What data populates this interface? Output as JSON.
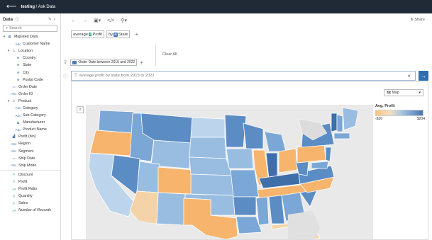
{
  "header": {
    "workbook": "testing",
    "page": "Ask Data"
  },
  "sidebar": {
    "title": "Data",
    "search_placeholder": "Search",
    "fields": [
      {
        "indent": 0,
        "twisty": "▾",
        "icon": "▦",
        "cls": "dim",
        "label": "Migrated Data",
        "icon_name": "table-icon"
      },
      {
        "indent": 2,
        "twisty": "",
        "icon": "Abc",
        "cls": "dim",
        "label": "Customer Name",
        "icon_name": "text-field-icon"
      },
      {
        "indent": 1,
        "twisty": "▾",
        "icon": "♙",
        "cls": "dim",
        "label": "Location",
        "icon_name": "hierarchy-icon"
      },
      {
        "indent": 2,
        "twisty": "",
        "icon": "⊕",
        "cls": "dim",
        "label": "Country",
        "icon_name": "globe-icon"
      },
      {
        "indent": 2,
        "twisty": "",
        "icon": "⊕",
        "cls": "dim",
        "label": "State",
        "icon_name": "globe-icon"
      },
      {
        "indent": 2,
        "twisty": "",
        "icon": "⊕",
        "cls": "dim",
        "label": "City",
        "icon_name": "globe-icon"
      },
      {
        "indent": 2,
        "twisty": "",
        "icon": "⊕",
        "cls": "dim",
        "label": "Postal Code",
        "icon_name": "globe-icon"
      },
      {
        "indent": 1,
        "twisty": "",
        "icon": "▭",
        "cls": "dim",
        "label": "Order Date",
        "icon_name": "calendar-icon"
      },
      {
        "indent": 1,
        "twisty": "",
        "icon": "Abc",
        "cls": "dim",
        "label": "Order ID",
        "icon_name": "text-field-icon"
      },
      {
        "indent": 1,
        "twisty": "▾",
        "icon": "♙",
        "cls": "dim",
        "label": "Product",
        "icon_name": "hierarchy-icon"
      },
      {
        "indent": 2,
        "twisty": "",
        "icon": "Abc",
        "cls": "dim",
        "label": "Category",
        "icon_name": "text-field-icon"
      },
      {
        "indent": 2,
        "twisty": "",
        "icon": "Abc",
        "cls": "dim",
        "label": "Sub-Category",
        "icon_name": "text-field-icon"
      },
      {
        "indent": 2,
        "twisty": "",
        "icon": "⧉",
        "cls": "dim",
        "label": "Manufacturer",
        "icon_name": "group-icon"
      },
      {
        "indent": 2,
        "twisty": "",
        "icon": "Abc",
        "cls": "dim",
        "label": "Product Name",
        "icon_name": "text-field-icon"
      },
      {
        "indent": 1,
        "twisty": "",
        "icon": "▟",
        "cls": "dim",
        "label": "Profit (bin)",
        "icon_name": "bin-icon"
      },
      {
        "indent": 1,
        "twisty": "",
        "icon": "Abc",
        "cls": "dim",
        "label": "Region",
        "icon_name": "text-field-icon"
      },
      {
        "indent": 1,
        "twisty": "",
        "icon": "Abc",
        "cls": "dim",
        "label": "Segment",
        "icon_name": "text-field-icon"
      },
      {
        "indent": 1,
        "twisty": "",
        "icon": "▭",
        "cls": "dim",
        "label": "Ship Date",
        "icon_name": "calendar-icon"
      },
      {
        "indent": 1,
        "twisty": "",
        "icon": "Abc",
        "cls": "dim",
        "label": "Ship Mode",
        "icon_name": "text-field-icon"
      },
      {
        "sep": true
      },
      {
        "indent": 1,
        "twisty": "",
        "icon": "#",
        "cls": "meas",
        "label": "Discount",
        "icon_name": "measure-icon"
      },
      {
        "indent": 1,
        "twisty": "",
        "icon": "#",
        "cls": "meas",
        "label": "Profit",
        "icon_name": "measure-icon"
      },
      {
        "indent": 1,
        "twisty": "",
        "icon": "=#",
        "cls": "meas",
        "label": "Profit Ratio",
        "icon_name": "calc-measure-icon"
      },
      {
        "indent": 1,
        "twisty": "",
        "icon": "#",
        "cls": "meas",
        "label": "Quantity",
        "icon_name": "measure-icon"
      },
      {
        "indent": 1,
        "twisty": "",
        "icon": "#",
        "cls": "meas",
        "label": "Sales",
        "icon_name": "measure-icon"
      },
      {
        "indent": 1,
        "twisty": "",
        "icon": "=#",
        "cls": "meas",
        "label": "Number of Records",
        "italic": true,
        "icon_name": "calc-measure-icon"
      }
    ]
  },
  "toolbar": {
    "share_label": "Share",
    "clear_all": "Clear All"
  },
  "query": {
    "pill1_prefix": "average",
    "pill1_field": "Profit",
    "pill2_prefix": "by",
    "pill2_field": "State",
    "filter": "Order Date between 2015 and 2022",
    "ask_text": "average profit by state from 2015 to 2022"
  },
  "viz": {
    "map_option": "Map",
    "legend_title": "Avg. Profit",
    "legend_min": "-$36",
    "legend_max": "$204",
    "colors": {
      "orange": "#f7b46d",
      "light_orange": "#f5d3a8",
      "pale_blue": "#bdd5ec",
      "light_blue": "#98bde0",
      "mid_blue": "#7aa7d5",
      "blue": "#5b8cc3",
      "dark_blue": "#3f6ea8"
    }
  }
}
